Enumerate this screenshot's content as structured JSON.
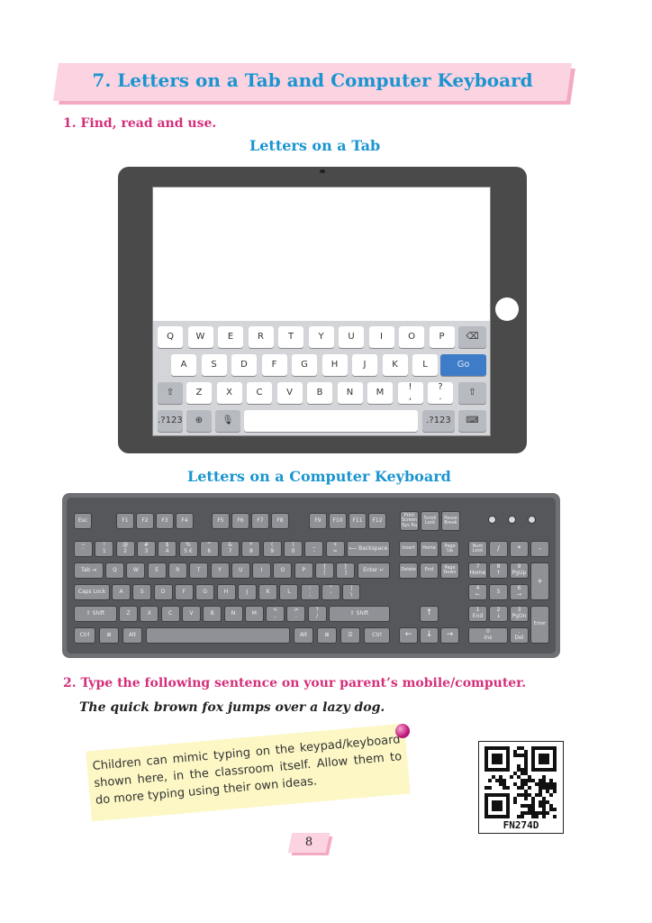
{
  "title": "7. Letters on a Tab and Computer Keyboard",
  "section1": {
    "label": "1. Find, read and use.",
    "tab_heading": "Letters on a Tab",
    "keyboard_heading": "Letters on a Computer Keyboard"
  },
  "tab_keyboard": {
    "row1": [
      "Q",
      "W",
      "E",
      "R",
      "T",
      "Y",
      "U",
      "I",
      "O",
      "P"
    ],
    "row2": [
      "A",
      "S",
      "D",
      "F",
      "G",
      "H",
      "J",
      "K",
      "L"
    ],
    "go_label": "Go",
    "row3": [
      "Z",
      "X",
      "C",
      "V",
      "B",
      "N",
      "M",
      "!\n,",
      "?\n."
    ],
    "num_label": ".?123"
  },
  "computer_keyboard": {
    "esc": "Esc",
    "f_keys": [
      "F1",
      "F2",
      "F3",
      "F4",
      "F5",
      "F6",
      "F7",
      "F8",
      "F9",
      "F10",
      "F11",
      "F12"
    ],
    "sys_keys": [
      "Print\nScreen\nSys Rq",
      "Scroll\nLock",
      "Pause\nBreak"
    ],
    "num_row": [
      "~\n`",
      "!\n1",
      "@\n2",
      "#\n3",
      "$\n4",
      "%\n5 €",
      "^\n6",
      "&\n7",
      "*\n8",
      "(\n9",
      ")\n0",
      "_\n-",
      "+\n="
    ],
    "backspace": "⟵ Backspace",
    "tab": "Tab ⇥",
    "q_row": [
      "Q",
      "W",
      "E",
      "R",
      "T",
      "Y",
      "U",
      "I",
      "O",
      "P",
      "{\n[",
      "}\n]",
      "|\n\\"
    ],
    "enter": "Enter ↵",
    "caps": "Caps Lock",
    "a_row": [
      "A",
      "S",
      "D",
      "F",
      "G",
      "H",
      "J",
      "K",
      "L",
      ":\n;",
      "\"\n'"
    ],
    "shift": "⇧ Shift",
    "z_row": [
      "Z",
      "X",
      "C",
      "V",
      "B",
      "N",
      "M",
      "<\n,",
      ">\n.",
      "?\n/"
    ],
    "ctrl": "Ctrl",
    "alt": "Alt",
    "nav_top": [
      "Insert",
      "Home",
      "Page\nUp"
    ],
    "nav_bottom": [
      "Delete",
      "End",
      "Page\nDown"
    ],
    "arrows": [
      "↑",
      "←",
      "↓",
      "→"
    ],
    "numpad": [
      "Num\nLock",
      "/",
      "*",
      "-",
      "7\nHome",
      "8\n↑",
      "9\nPgUp",
      "+",
      "4\n←",
      "5",
      "6\n→",
      "1\nEnd",
      "2\n↓",
      "3\nPgDn",
      "Enter",
      "0\nIns",
      ".\nDel"
    ]
  },
  "section2": {
    "label": "2. Type the following sentence on your parent’s mobile/computer.",
    "sentence": "The quick brown fox jumps over a lazy dog."
  },
  "note": "Children can mimic typing on the keypad/keyboard shown here, in the classroom itself. Allow them to do more typing using their own ideas.",
  "qr_code": "FN274D",
  "page_number": "8"
}
